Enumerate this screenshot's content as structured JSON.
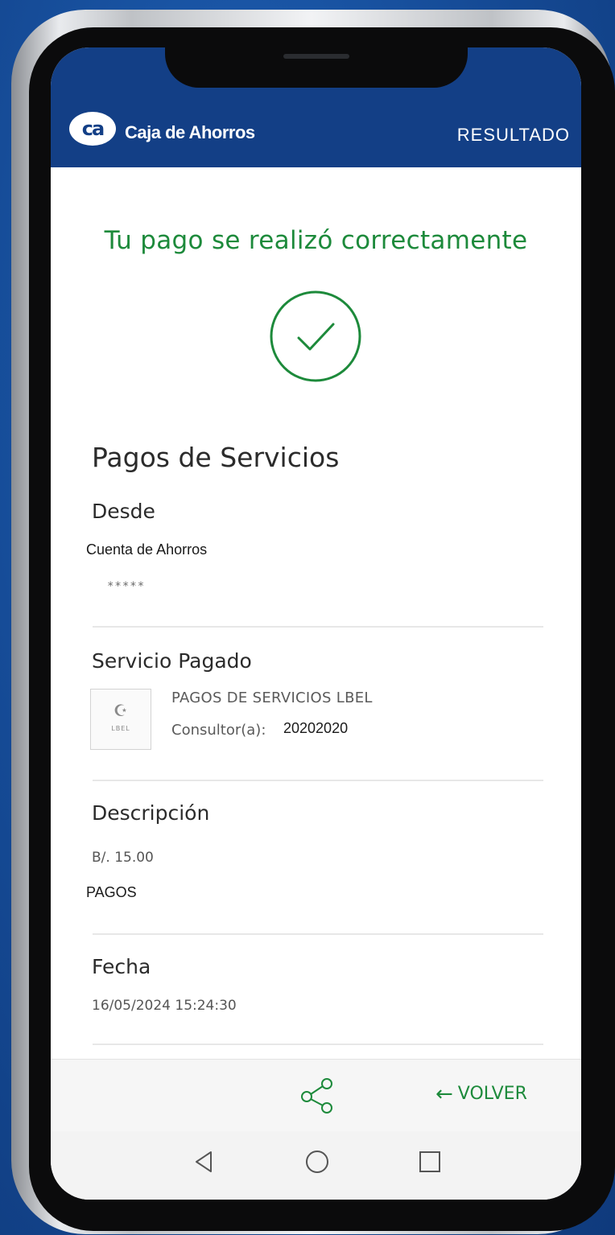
{
  "header": {
    "logo_mark": "ca",
    "brand_name": "Caja de Ahorros",
    "screen_title": "RESULTADO"
  },
  "status": {
    "message": "Tu pago se realizó correctamente",
    "icon": "check-circle-icon",
    "color": "#1d8a3b"
  },
  "receipt": {
    "heading": "Pagos de Servicios",
    "from": {
      "label": "Desde",
      "account_type": "Cuenta de Ahorros",
      "account_masked": "*****"
    },
    "service": {
      "label": "Servicio Pagado",
      "logo_icon": "lbel-logo-icon",
      "logo_text": "LBEL",
      "name": "PAGOS DE SERVICIOS LBEL",
      "consultant_label": "Consultor(a):",
      "consultant_value": "20202020"
    },
    "description": {
      "label": "Descripción",
      "amount": "B/. 15.00",
      "concept": "PAGOS"
    },
    "date": {
      "label": "Fecha",
      "value": "16/05/2024 15:24:30"
    }
  },
  "actions": {
    "share_icon": "share-icon",
    "back_label": "VOLVER",
    "back_arrow": "←"
  },
  "system_nav": {
    "back_icon": "triangle-back-icon",
    "home_icon": "circle-home-icon",
    "recents_icon": "square-recents-icon"
  },
  "colors": {
    "brand_blue": "#133f86",
    "accent_green": "#1d8a3b",
    "background": "#154a95"
  }
}
